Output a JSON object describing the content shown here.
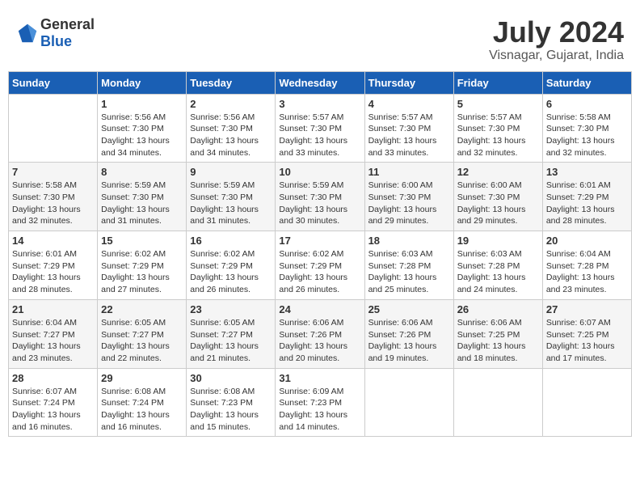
{
  "header": {
    "logo_general": "General",
    "logo_blue": "Blue",
    "month_year": "July 2024",
    "location": "Visnagar, Gujarat, India"
  },
  "weekdays": [
    "Sunday",
    "Monday",
    "Tuesday",
    "Wednesday",
    "Thursday",
    "Friday",
    "Saturday"
  ],
  "weeks": [
    [
      {
        "day": "",
        "info": ""
      },
      {
        "day": "1",
        "info": "Sunrise: 5:56 AM\nSunset: 7:30 PM\nDaylight: 13 hours\nand 34 minutes."
      },
      {
        "day": "2",
        "info": "Sunrise: 5:56 AM\nSunset: 7:30 PM\nDaylight: 13 hours\nand 34 minutes."
      },
      {
        "day": "3",
        "info": "Sunrise: 5:57 AM\nSunset: 7:30 PM\nDaylight: 13 hours\nand 33 minutes."
      },
      {
        "day": "4",
        "info": "Sunrise: 5:57 AM\nSunset: 7:30 PM\nDaylight: 13 hours\nand 33 minutes."
      },
      {
        "day": "5",
        "info": "Sunrise: 5:57 AM\nSunset: 7:30 PM\nDaylight: 13 hours\nand 32 minutes."
      },
      {
        "day": "6",
        "info": "Sunrise: 5:58 AM\nSunset: 7:30 PM\nDaylight: 13 hours\nand 32 minutes."
      }
    ],
    [
      {
        "day": "7",
        "info": "Sunrise: 5:58 AM\nSunset: 7:30 PM\nDaylight: 13 hours\nand 32 minutes."
      },
      {
        "day": "8",
        "info": "Sunrise: 5:59 AM\nSunset: 7:30 PM\nDaylight: 13 hours\nand 31 minutes."
      },
      {
        "day": "9",
        "info": "Sunrise: 5:59 AM\nSunset: 7:30 PM\nDaylight: 13 hours\nand 31 minutes."
      },
      {
        "day": "10",
        "info": "Sunrise: 5:59 AM\nSunset: 7:30 PM\nDaylight: 13 hours\nand 30 minutes."
      },
      {
        "day": "11",
        "info": "Sunrise: 6:00 AM\nSunset: 7:30 PM\nDaylight: 13 hours\nand 29 minutes."
      },
      {
        "day": "12",
        "info": "Sunrise: 6:00 AM\nSunset: 7:30 PM\nDaylight: 13 hours\nand 29 minutes."
      },
      {
        "day": "13",
        "info": "Sunrise: 6:01 AM\nSunset: 7:29 PM\nDaylight: 13 hours\nand 28 minutes."
      }
    ],
    [
      {
        "day": "14",
        "info": "Sunrise: 6:01 AM\nSunset: 7:29 PM\nDaylight: 13 hours\nand 28 minutes."
      },
      {
        "day": "15",
        "info": "Sunrise: 6:02 AM\nSunset: 7:29 PM\nDaylight: 13 hours\nand 27 minutes."
      },
      {
        "day": "16",
        "info": "Sunrise: 6:02 AM\nSunset: 7:29 PM\nDaylight: 13 hours\nand 26 minutes."
      },
      {
        "day": "17",
        "info": "Sunrise: 6:02 AM\nSunset: 7:29 PM\nDaylight: 13 hours\nand 26 minutes."
      },
      {
        "day": "18",
        "info": "Sunrise: 6:03 AM\nSunset: 7:28 PM\nDaylight: 13 hours\nand 25 minutes."
      },
      {
        "day": "19",
        "info": "Sunrise: 6:03 AM\nSunset: 7:28 PM\nDaylight: 13 hours\nand 24 minutes."
      },
      {
        "day": "20",
        "info": "Sunrise: 6:04 AM\nSunset: 7:28 PM\nDaylight: 13 hours\nand 23 minutes."
      }
    ],
    [
      {
        "day": "21",
        "info": "Sunrise: 6:04 AM\nSunset: 7:27 PM\nDaylight: 13 hours\nand 23 minutes."
      },
      {
        "day": "22",
        "info": "Sunrise: 6:05 AM\nSunset: 7:27 PM\nDaylight: 13 hours\nand 22 minutes."
      },
      {
        "day": "23",
        "info": "Sunrise: 6:05 AM\nSunset: 7:27 PM\nDaylight: 13 hours\nand 21 minutes."
      },
      {
        "day": "24",
        "info": "Sunrise: 6:06 AM\nSunset: 7:26 PM\nDaylight: 13 hours\nand 20 minutes."
      },
      {
        "day": "25",
        "info": "Sunrise: 6:06 AM\nSunset: 7:26 PM\nDaylight: 13 hours\nand 19 minutes."
      },
      {
        "day": "26",
        "info": "Sunrise: 6:06 AM\nSunset: 7:25 PM\nDaylight: 13 hours\nand 18 minutes."
      },
      {
        "day": "27",
        "info": "Sunrise: 6:07 AM\nSunset: 7:25 PM\nDaylight: 13 hours\nand 17 minutes."
      }
    ],
    [
      {
        "day": "28",
        "info": "Sunrise: 6:07 AM\nSunset: 7:24 PM\nDaylight: 13 hours\nand 16 minutes."
      },
      {
        "day": "29",
        "info": "Sunrise: 6:08 AM\nSunset: 7:24 PM\nDaylight: 13 hours\nand 16 minutes."
      },
      {
        "day": "30",
        "info": "Sunrise: 6:08 AM\nSunset: 7:23 PM\nDaylight: 13 hours\nand 15 minutes."
      },
      {
        "day": "31",
        "info": "Sunrise: 6:09 AM\nSunset: 7:23 PM\nDaylight: 13 hours\nand 14 minutes."
      },
      {
        "day": "",
        "info": ""
      },
      {
        "day": "",
        "info": ""
      },
      {
        "day": "",
        "info": ""
      }
    ]
  ]
}
